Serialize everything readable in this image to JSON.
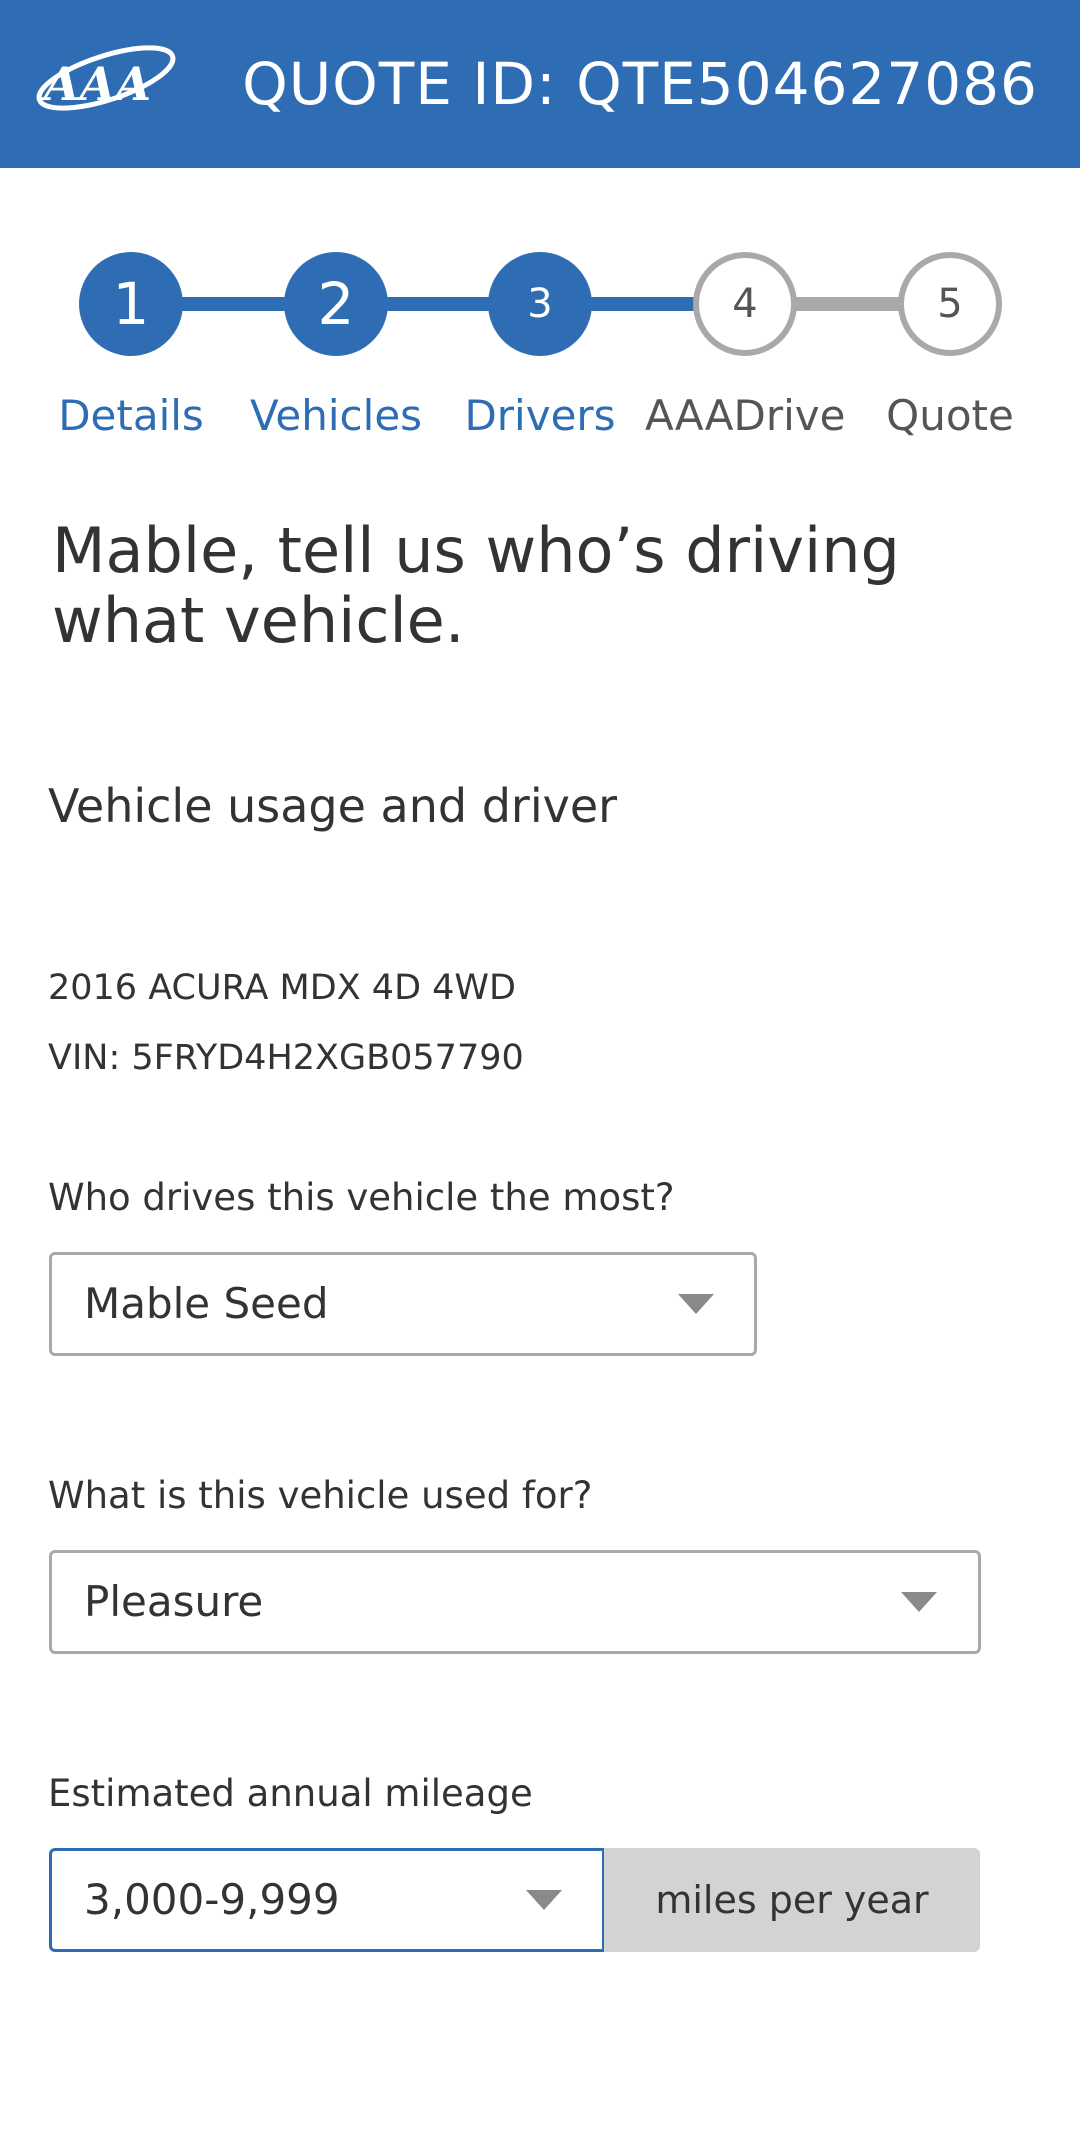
{
  "header": {
    "quote_id": "QUOTE ID: QTE504627086",
    "logo": "AAA",
    "background": "#2e6db4"
  },
  "stepper": {
    "steps": [
      {
        "number": "1",
        "label": "Details",
        "state": "complete"
      },
      {
        "number": "2",
        "label": "Vehicles",
        "state": "complete"
      },
      {
        "number": "3",
        "label": "Drivers",
        "state": "current"
      },
      {
        "number": "4",
        "label": "AAADrive",
        "state": "upcoming"
      },
      {
        "number": "5",
        "label": "Quote",
        "state": "upcoming"
      }
    ],
    "active_color": "#2e6db4",
    "inactive_color": "#a9a9a9"
  },
  "main": {
    "headline": "Mable, tell us who’s driving what vehicle.",
    "section_title": "Vehicle usage and driver",
    "vehicle": {
      "name": "2016 ACURA MDX 4D 4WD",
      "vin": "VIN: 5FRYD4H2XGB057790"
    },
    "driver_field": {
      "label": "Who drives this vehicle the most?",
      "value": "Mable Seed",
      "icon": "chevron-down-icon"
    },
    "usage_field": {
      "label": "What is this vehicle used for?",
      "value": "Pleasure",
      "icon": "chevron-down-icon"
    },
    "mileage_field": {
      "label": "Estimated annual mileage",
      "value": "3,000-9,999",
      "unit": "miles per year",
      "icon": "chevron-down-icon"
    }
  }
}
